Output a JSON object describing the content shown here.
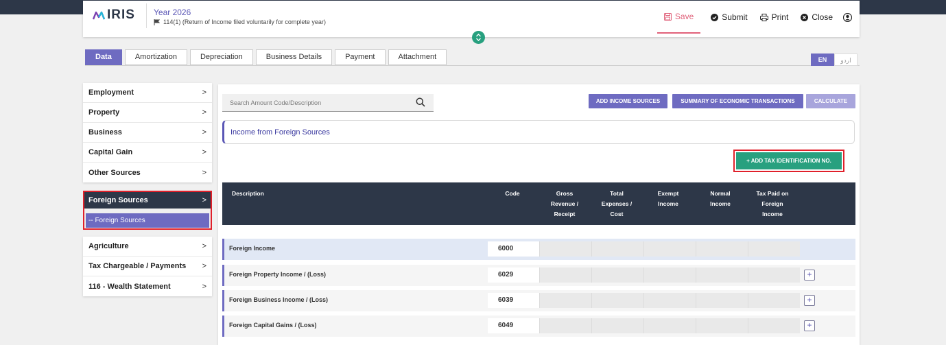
{
  "header": {
    "logo_text": "IRIS",
    "year": "Year 2026",
    "return_type": "114(1) (Return of Income filed voluntarily for complete year)",
    "actions": {
      "save": "Save",
      "submit": "Submit",
      "print": "Print",
      "close": "Close"
    }
  },
  "tabs": [
    "Data",
    "Amortization",
    "Depreciation",
    "Business Details",
    "Payment",
    "Attachment"
  ],
  "lang": {
    "en": "EN",
    "ur": "اردو"
  },
  "sidebar": {
    "group1": [
      "Employment",
      "Property",
      "Business",
      "Capital Gain",
      "Other Sources"
    ],
    "foreign": {
      "label": "Foreign Sources",
      "sub": "-- Foreign Sources"
    },
    "group2": [
      "Agriculture",
      "Tax Chargeable / Payments",
      "116 - Wealth Statement"
    ],
    "chevron": ">"
  },
  "search": {
    "placeholder": "Search Amount Code/Description"
  },
  "buttons": {
    "add_income": "ADD INCOME SOURCES",
    "summary": "SUMMARY OF ECONOMIC TRANSACTIONS",
    "calculate": "CALCULATE",
    "add_tax_id": "+ ADD TAX IDENTIFICATION NO."
  },
  "section_title": "Income from Foreign Sources",
  "table": {
    "columns": {
      "description": "Description",
      "code": "Code",
      "gross": "Gross Revenue / Receipt",
      "total_exp": "Total Expenses / Cost",
      "exempt": "Exempt Income",
      "normal": "Normal Income",
      "tax_paid": "Tax Paid on Foreign Income"
    },
    "rows": [
      {
        "desc": "Foreign Income",
        "code": "6000"
      },
      {
        "desc": "Foreign Property Income / (Loss)",
        "code": "6029"
      },
      {
        "desc": "Foreign Business Income / (Loss)",
        "code": "6039"
      },
      {
        "desc": "Foreign Capital Gains / (Loss)",
        "code": "6049"
      }
    ],
    "plus_label": "+"
  },
  "colors": {
    "accent": "#6e6bc1",
    "dark": "#2d3748",
    "green": "#28a07f",
    "highlight": "#e0202a",
    "save": "#e0617a"
  }
}
